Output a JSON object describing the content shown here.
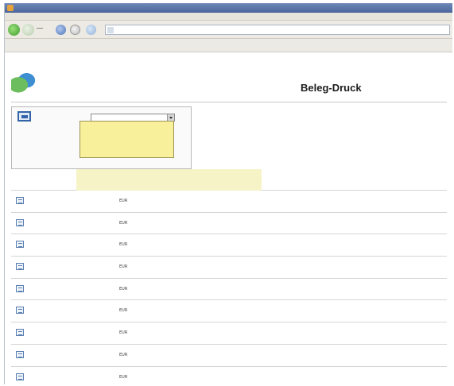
{
  "window": {
    "title": ""
  },
  "menu": [
    "",
    "",
    "",
    "",
    "",
    "",
    "",
    ""
  ],
  "address": {
    "url": ""
  },
  "header": {
    "logo_text": "",
    "page_title": "Beleg-Druck"
  },
  "filter": {
    "belegart_label": "",
    "belegnummer_label": "",
    "belegdatum_label": "",
    "sortierung_label": "",
    "side_label": "",
    "selected_option": "",
    "options": [
      "",
      "",
      "",
      "",
      ""
    ]
  },
  "toolbar": {
    "links": [
      "",
      "",
      "",
      ""
    ]
  },
  "rows": [
    {
      "nr": "",
      "amount": "",
      "currency": "EUR",
      "type": ""
    },
    {
      "nr": "",
      "amount": "",
      "currency": "EUR",
      "type": ""
    },
    {
      "nr": "",
      "amount": "",
      "currency": "EUR",
      "type": ""
    },
    {
      "nr": "",
      "amount": "",
      "currency": "EUR",
      "type": ""
    },
    {
      "nr": "",
      "amount": "",
      "currency": "EUR",
      "type": ""
    },
    {
      "nr": "",
      "amount": "",
      "currency": "EUR",
      "type": ""
    },
    {
      "nr": "",
      "amount": "",
      "currency": "EUR",
      "type": ""
    },
    {
      "nr": "",
      "amount": "",
      "currency": "EUR",
      "type": ""
    },
    {
      "nr": "",
      "amount": "",
      "currency": "EUR",
      "type": ""
    }
  ]
}
